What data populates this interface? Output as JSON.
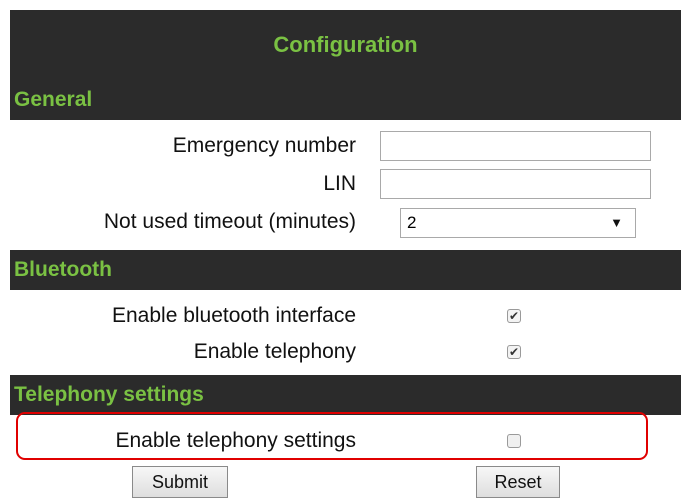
{
  "title": "Configuration",
  "sections": {
    "general": {
      "header": "General",
      "emergency_number_label": "Emergency number",
      "emergency_number_value": "",
      "lin_label": "LIN",
      "lin_value": "",
      "timeout_label": "Not used timeout (minutes)",
      "timeout_value": "2"
    },
    "bluetooth": {
      "header": "Bluetooth",
      "enable_interface_label": "Enable bluetooth interface",
      "enable_interface_checked": true,
      "enable_telephony_label": "Enable telephony",
      "enable_telephony_checked": true
    },
    "telephony": {
      "header": "Telephony settings",
      "enable_settings_label": "Enable telephony settings",
      "enable_settings_checked": false
    }
  },
  "buttons": {
    "submit": "Submit",
    "reset": "Reset"
  },
  "colors": {
    "header_bg": "#2b2b2b",
    "header_text": "#7ac143",
    "highlight": "#e00000"
  },
  "icons": {
    "checkmark": "✔",
    "dropdown": "▼"
  }
}
